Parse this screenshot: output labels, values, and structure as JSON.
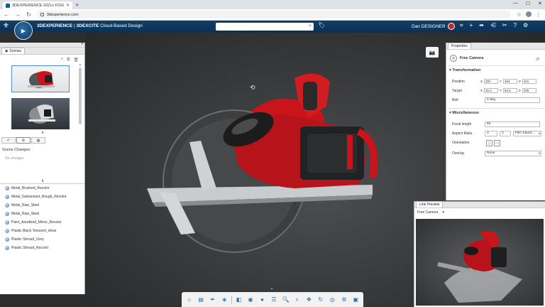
{
  "browser": {
    "tab_title": "3DEXPERIENCE 2021x FD02",
    "url": "3dexperience.com"
  },
  "header": {
    "brand": "3DEXPERIENCE",
    "separator": " | ",
    "app_brand": "3DEXCITE",
    "app_name": " Cloud-Based Design",
    "user": "Dan DESIGNER"
  },
  "scenes": {
    "tab_label": "Scenes",
    "changes_title": "Scene Changes",
    "changes_empty": "No changes"
  },
  "materials": [
    "Metal_Brushed_Recolor",
    "Metal_Galvanized_Rough_Recolor",
    "Metal_Raw_Steel",
    "Metal_Raw_Steel",
    "Paint_Anodized_Mirror_Recolor",
    "Plastic Black Textured_sticar",
    "Plastic Shroud_Grey",
    "Plastic Shroud_Recolor"
  ],
  "properties": {
    "tab_label": "Properties",
    "object_name": "Free Camera",
    "transformation_label": "Transformation",
    "position_label": "Position",
    "position": {
      "x": "381",
      "y": "464",
      "z": "101"
    },
    "target_label": "Target",
    "target": {
      "x": "26.3",
      "y": "64.6",
      "z": "106"
    },
    "roll_label": "Roll",
    "roll_value": "0 deg",
    "misc_label": "Miscellaneous",
    "focal_label": "Focal length",
    "focal_value": "50",
    "aspect_label": "Aspect Ratio",
    "aspect_w": "3",
    "aspect_h": "2",
    "aspect_preset": "Film Stand...",
    "orientation_label": "Orientation",
    "overlay_label": "Overlay",
    "overlay_value": "None"
  },
  "link_preview": {
    "tab_label": "Link Preview",
    "camera": "Free Camera"
  },
  "colors": {
    "header_bg": "#0b3154",
    "accent": "#2a6da8",
    "saw_red": "#c8141a"
  }
}
